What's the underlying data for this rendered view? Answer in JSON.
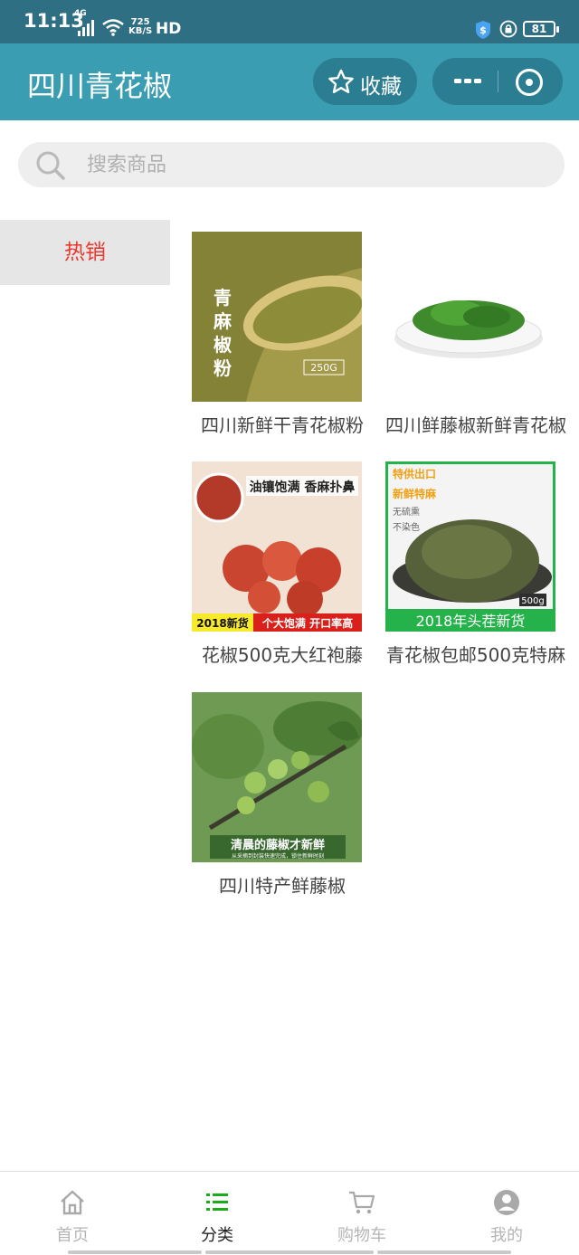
{
  "status_bar": {
    "time": "11:13",
    "network": "4G",
    "speed_value": "725",
    "speed_unit": "KB/S",
    "hd": "HD",
    "battery": "81"
  },
  "header": {
    "title": "四川青花椒",
    "favorite_label": "收藏",
    "more_icon": "more-dots-icon",
    "close_icon": "close-circle-icon"
  },
  "search": {
    "placeholder": "搜索商品"
  },
  "sidebar": {
    "items": [
      {
        "label": "热销",
        "selected": true
      }
    ]
  },
  "products": [
    {
      "name": "四川新鲜干青花椒粉",
      "image_text": "青麻椒粉",
      "image_badge": "250G"
    },
    {
      "name": "四川鲜藤椒新鲜青花椒"
    },
    {
      "name": "花椒500克大红袍藤",
      "image_caption_top": "油镶饱满 香麻扑鼻",
      "image_caption_year": "2018新货",
      "image_caption_bottom": "个大饱满 开口率高"
    },
    {
      "name": "青花椒包邮500克特麻",
      "image_caption_top": "特供出口",
      "image_caption_2": "新鲜特麻",
      "image_caption_3": "无硫熏",
      "image_caption_4": "不染色",
      "image_badge": "500g",
      "image_caption_bottom": "2018年头茬新货"
    },
    {
      "name": "四川特产鲜藤椒",
      "image_caption": "清晨的藤椒才新鲜",
      "image_subcaption": "从采摘到封装快速完成，锁住新鲜时刻"
    }
  ],
  "tabbar": {
    "tabs": [
      {
        "label": "首页",
        "icon": "home-icon",
        "active": false
      },
      {
        "label": "分类",
        "icon": "list-icon",
        "active": true
      },
      {
        "label": "购物车",
        "icon": "cart-icon",
        "active": false
      },
      {
        "label": "我的",
        "icon": "user-icon",
        "active": false
      }
    ]
  },
  "colors": {
    "header": "#3a9db2",
    "status_bar": "#2f6f84",
    "active_tab": "#1aad19",
    "sidebar_selected_text": "#e8382f"
  }
}
